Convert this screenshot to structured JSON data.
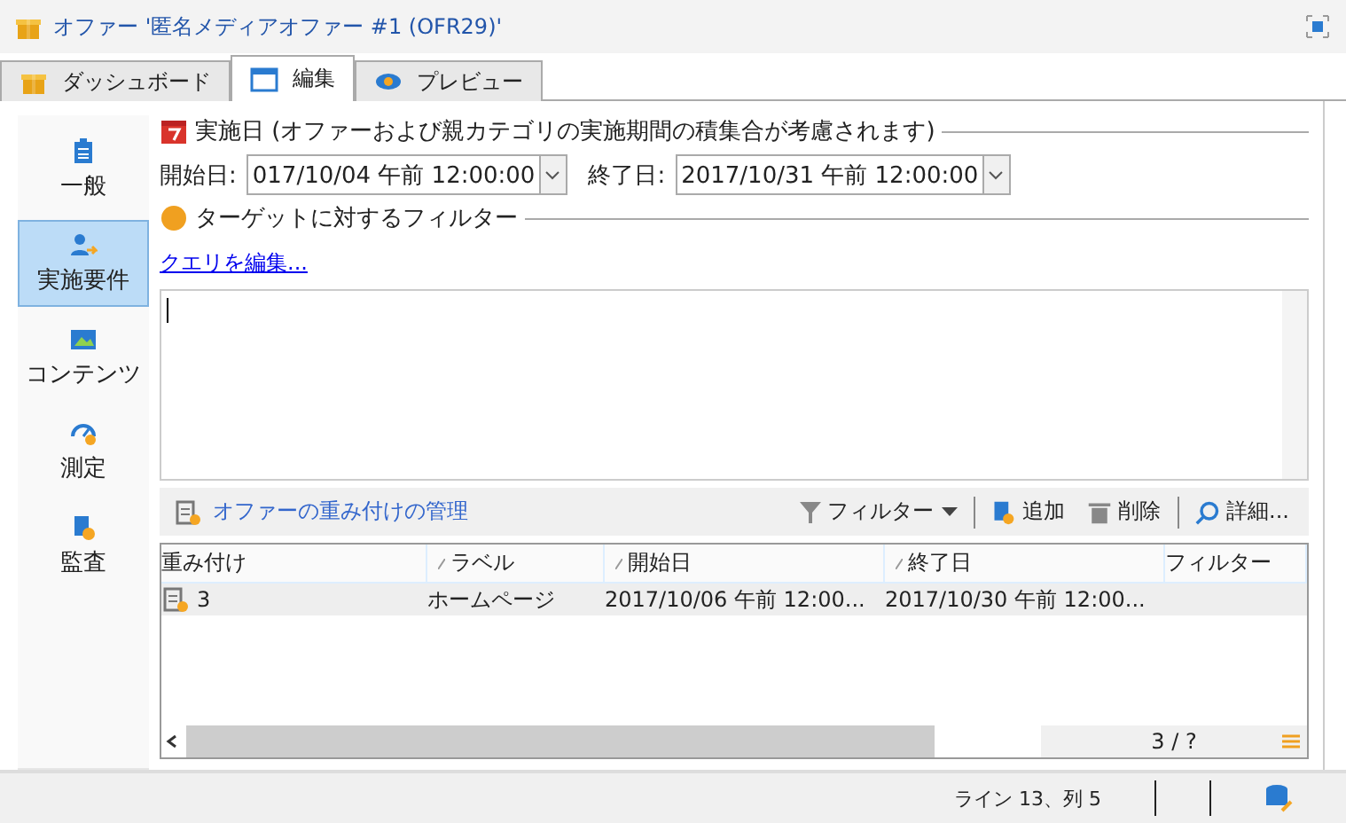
{
  "window": {
    "title": "オファー '匿名メディアオファー #1 (OFR29)'"
  },
  "tabs": [
    {
      "label": "ダッシュボード",
      "selected": false
    },
    {
      "label": "編集",
      "selected": true
    },
    {
      "label": "プレビュー",
      "selected": false
    }
  ],
  "sidebar": {
    "items": [
      {
        "label": "一般",
        "selected": false
      },
      {
        "label": "実施要件",
        "selected": true
      },
      {
        "label": "コンテンツ",
        "selected": false
      },
      {
        "label": "測定",
        "selected": false
      },
      {
        "label": "監査",
        "selected": false
      }
    ]
  },
  "validity": {
    "title": "実施日 (オファーおよび親カテゴリの実施期間の積集合が考慮されます)",
    "start_label": "開始日:",
    "start_value": "017/10/04 午前 12:00:00",
    "end_label": "終了日:",
    "end_value": "2017/10/31 午前 12:00:00"
  },
  "filter": {
    "title": "ターゲットに対するフィルター",
    "edit_link": "クエリを編集..."
  },
  "toolbar": {
    "manage_link": "オファーの重み付けの管理",
    "filter": "フィルター",
    "add": "追加",
    "delete": "削除",
    "details": "詳細..."
  },
  "table": {
    "columns": [
      "重み付け",
      "ラベル",
      "開始日",
      "終了日",
      "フィルター"
    ],
    "rows": [
      {
        "cells": [
          "3",
          "ホームページ",
          "2017/10/06 午前 12:00...",
          "2017/10/30 午前 12:00..."
        ],
        "selected": true
      }
    ],
    "pager": "3 / ?"
  },
  "status_bar": {
    "position": "ライン 13、列 5"
  }
}
